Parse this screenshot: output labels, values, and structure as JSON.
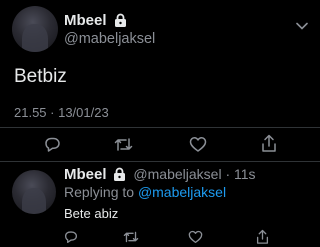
{
  "main_tweet": {
    "author_name": "Mbeel",
    "handle": "@mabeljaksel",
    "text": "Betbiz",
    "timestamp": "21.55 · 13/01/23"
  },
  "reply": {
    "author_name": "Mbeel",
    "handle_time": "@mabeljaksel · 11s",
    "replying_prefix": "Replying to",
    "replying_to": "@mabeljaksel",
    "text": "Bete abiz"
  },
  "icons": {
    "lock": "lock-icon",
    "more": "chevron-down-icon",
    "reply": "comment-icon",
    "retweet": "retweet-icon",
    "like": "heart-icon",
    "share": "share-icon"
  },
  "colors": {
    "background": "#000000",
    "text": "#e7e9ea",
    "muted": "#8b8f96",
    "link": "#1d9bf0",
    "divider": "#2f3336"
  }
}
